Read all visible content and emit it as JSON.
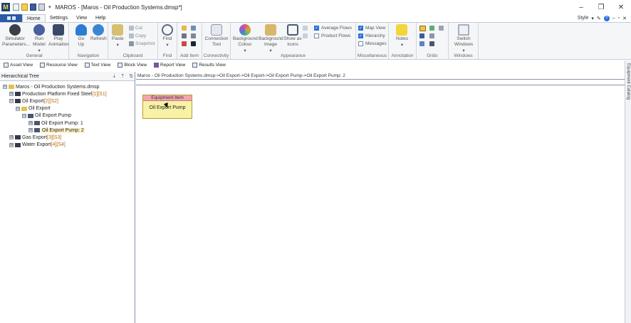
{
  "window": {
    "app_logo": "M",
    "title": "MAROS - [Maros - Oil Production Systems.dmsp*]",
    "qa_more": "▾",
    "controls": {
      "minimize": "–",
      "restore": "❐",
      "close": "✕"
    }
  },
  "menu": {
    "tabs": [
      "Home",
      "Settings",
      "View",
      "Help"
    ],
    "style_label": "Style",
    "style_arrow": "▾",
    "extras": [
      "✎",
      "?",
      "–",
      "▫",
      "✕"
    ]
  },
  "ribbon": {
    "groups": {
      "general": {
        "label": "General",
        "buttons": [
          {
            "label": "Simulator Parameters...",
            "icon": "gear-icon",
            "color": "#3b3f48"
          },
          {
            "label": "Run Model",
            "icon": "run-icon",
            "color": "#4a5fa0",
            "arrow": "▾"
          },
          {
            "label": "Play Animation",
            "icon": "play-icon",
            "color": "#3a4a66"
          }
        ]
      },
      "navigation": {
        "label": "Navigation",
        "buttons": [
          {
            "label": "Go Up",
            "icon": "go-up-icon",
            "color": "#2f7bd2"
          },
          {
            "label": "Refresh",
            "icon": "refresh-icon",
            "color": "#3a86d4"
          }
        ]
      },
      "clipboard": {
        "label": "Clipboard",
        "paste": {
          "label": "Paste",
          "icon": "paste-icon",
          "color": "#d7bf6f",
          "arrow": "▾"
        },
        "small": [
          {
            "label": "Cut",
            "icon": "cut-icon"
          },
          {
            "label": "Copy",
            "icon": "copy-icon"
          },
          {
            "label": "Snapshot",
            "icon": "snapshot-icon"
          }
        ]
      },
      "find": {
        "label": "Find",
        "button": {
          "label": "Find",
          "icon": "find-icon",
          "color": "#5a6a86",
          "arrow": "▾"
        }
      },
      "add_item": {
        "label": "Add Item"
      },
      "connectivity": {
        "label": "Connectivity",
        "button": {
          "label": "Connection Tool",
          "icon": "connection-tool-icon",
          "color": "#8c96a8"
        }
      },
      "appearance": {
        "label": "Appearance",
        "buttons": [
          {
            "label": "Background Colour",
            "icon": "background-colour-icon",
            "color": "#d25a7c",
            "arrow": "▾"
          },
          {
            "label": "Background Image",
            "icon": "background-image-icon",
            "color": "#d8b76a",
            "arrow": "▾"
          },
          {
            "label": "Show as Icons",
            "icon": "show-as-icons-icon",
            "color": "#4a5a76"
          }
        ],
        "checks": [
          {
            "label": "Average Flows",
            "checked": true
          },
          {
            "label": "Product Flows",
            "checked": false
          }
        ]
      },
      "miscellaneous": {
        "label": "Miscellaneous",
        "checks": [
          {
            "label": "Map View",
            "checked": true
          },
          {
            "label": "Hierarchy",
            "checked": true
          },
          {
            "label": "Messages",
            "checked": false
          }
        ]
      },
      "annotation": {
        "label": "Annotation",
        "button": {
          "label": "Notes",
          "icon": "notes-icon",
          "color": "#f4d53a",
          "arrow": "▾"
        }
      },
      "grids": {
        "label": "Grids"
      },
      "windows": {
        "label": "Windows",
        "button": {
          "label": "Switch Windows",
          "icon": "switch-windows-icon",
          "color": "#a6b0c0",
          "arrow": "▾"
        }
      }
    }
  },
  "views": [
    "Asset View",
    "Resource View",
    "Text View",
    "Block View",
    "Report View",
    "Results View"
  ],
  "tree": {
    "title": "Hierarchical Tree",
    "tools": [
      "⇣",
      "⇡",
      "⇅"
    ],
    "nodes": [
      {
        "level": 0,
        "expander": "⊟",
        "text": "Maros - Oil Production Systems.dmsp",
        "tag": "",
        "icon_color": "#e2c24a"
      },
      {
        "level": 1,
        "expander": "⊞",
        "text": "Production Platform Fixed Steel ",
        "tag": "[1][S1]",
        "icon_color": "#333a48"
      },
      {
        "level": 1,
        "expander": "⊟",
        "text": "Oil Export ",
        "tag": "[2][S2]",
        "icon_color": "#333a48"
      },
      {
        "level": 2,
        "expander": "⊟",
        "text": "Oil Export",
        "tag": "",
        "icon_color": "#e2c24a"
      },
      {
        "level": 3,
        "expander": "⊟",
        "text": "Oil Export Pump",
        "tag": "",
        "icon_color": "#4a5670"
      },
      {
        "level": 4,
        "expander": "⊞",
        "text": "Oil Export Pump: 1",
        "tag": "",
        "icon_color": "#4a5670"
      },
      {
        "level": 4,
        "expander": "⊞",
        "text": "Oil Export Pump: 2",
        "tag": "",
        "icon_color": "#4a5670",
        "selected": true
      },
      {
        "level": 1,
        "expander": "⊞",
        "text": "Gas Export ",
        "tag": "[3][S3]",
        "icon_color": "#333a48"
      },
      {
        "level": 1,
        "expander": "⊞",
        "text": "Water Export ",
        "tag": "[4][S4]",
        "icon_color": "#333a48"
      }
    ]
  },
  "main": {
    "breadcrumb": "Maros - Oil Production Systems.dmsp->Oil Export->Oil Export->Oil Export Pump->Oil Export Pump: 2",
    "equipment": {
      "header": "Equipment Item",
      "label": "Oil Export Pump"
    }
  },
  "side_panel": {
    "label": "Equipment Catalog"
  }
}
